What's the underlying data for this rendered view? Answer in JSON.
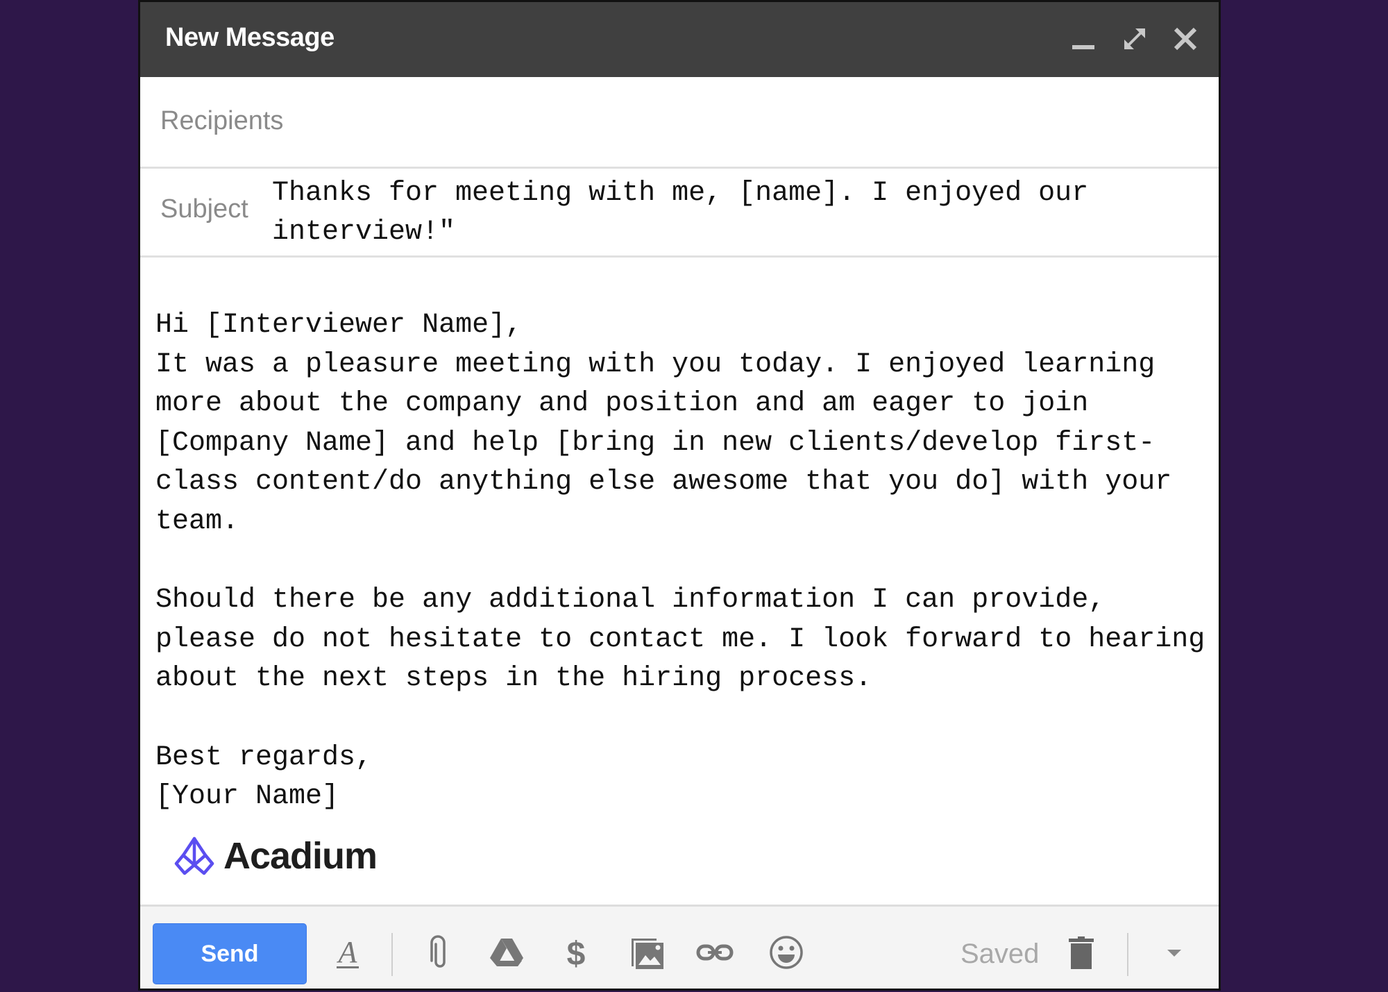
{
  "window": {
    "title": "New Message",
    "controls": {
      "minimize": "minimize-icon",
      "expand": "expand-icon",
      "close": "close-icon"
    }
  },
  "recipients": {
    "label": "Recipients",
    "value": ""
  },
  "subject": {
    "label": "Subject",
    "value": "Thanks for meeting with me, [name]. I enjoyed our interview!\""
  },
  "body": {
    "text": "Hi [Interviewer Name],\nIt was a pleasure meeting with you today. I enjoyed learning more about the company and position and am eager to join [Company Name] and help [bring in new clients/develop first-class content/do anything else awesome that you do] with your team.\n\nShould there be any additional information I can provide, please do not hesitate to contact me. I look forward to hearing about the next steps in the hiring process.\n\nBest regards,\n[Your Name]"
  },
  "signature": {
    "logo_text": "Acadium",
    "logo_color": "#5b4ef0"
  },
  "toolbar": {
    "send_label": "Send",
    "status": "Saved",
    "send_color": "#4a8af4",
    "icons": [
      "formatting-options-icon",
      "attach-file-icon",
      "google-drive-icon",
      "send-money-icon",
      "insert-photo-icon",
      "insert-link-icon",
      "insert-emoji-icon",
      "discard-draft-icon",
      "more-options-icon"
    ]
  },
  "colors": {
    "background": "#2e1749",
    "titlebar": "#404040",
    "toolbar": "#f4f4f4"
  }
}
